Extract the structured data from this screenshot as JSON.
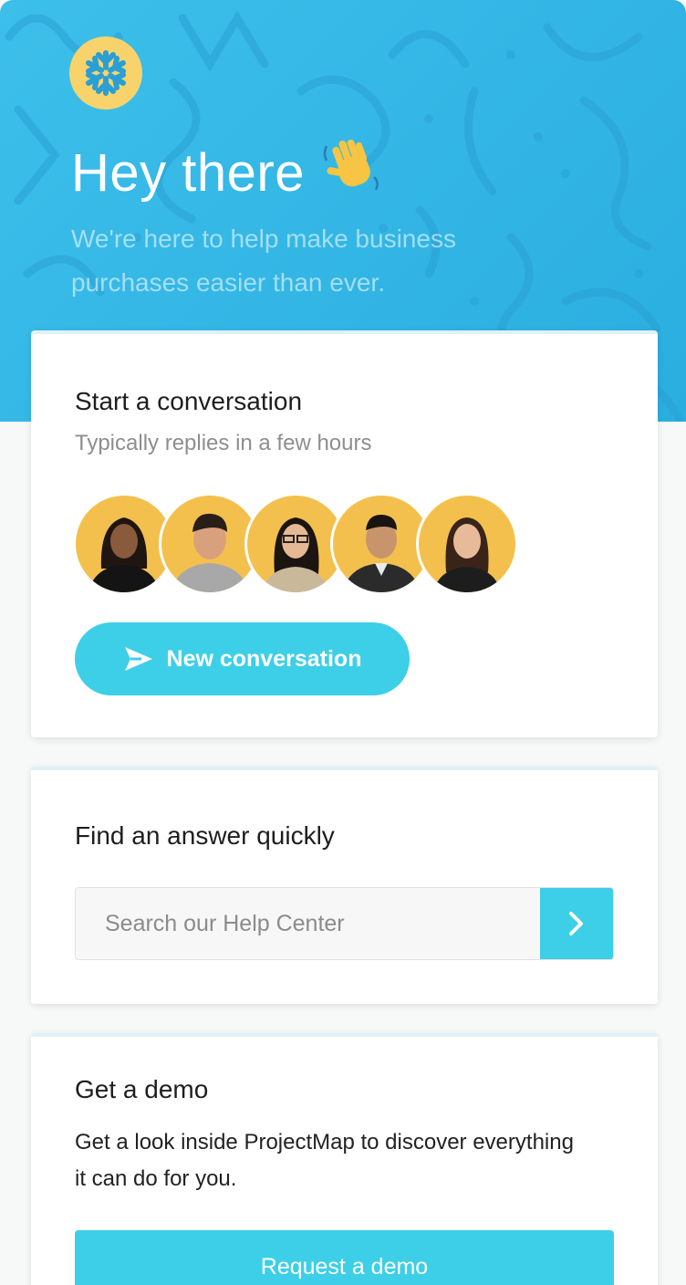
{
  "header": {
    "greeting": "Hey there",
    "wave_emoji": "👋",
    "tagline": "We're here to help make business purchases easier than ever.",
    "logo_icon": "snowflake-logo-icon",
    "colors": {
      "background": "#2fb4e4",
      "logo_bg": "#f8d36b",
      "logo_mark": "#2a9fd6"
    }
  },
  "conversation_card": {
    "title": "Start a conversation",
    "subtitle": "Typically replies in a few hours",
    "team_avatar_count": 5,
    "new_conversation_label": "New conversation",
    "send_icon": "paper-plane-icon"
  },
  "answer_card": {
    "title": "Find an answer quickly",
    "search_placeholder": "Search our Help Center",
    "search_value": "",
    "submit_icon": "chevron-right-icon"
  },
  "demo_card": {
    "title": "Get a demo",
    "body": "Get a look inside ProjectMap to discover everything it can do for you.",
    "request_label": "Request a demo"
  },
  "colors": {
    "accent": "#3dcfe7",
    "avatar_bg": "#f4c04d"
  }
}
